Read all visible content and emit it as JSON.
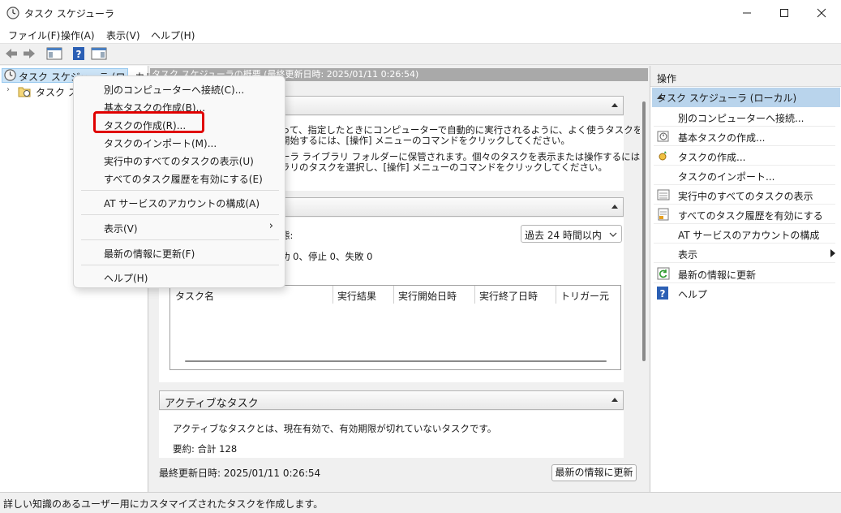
{
  "window": {
    "title": "タスク スケジューラ",
    "menu": [
      "ファイル(F)",
      "操作(A)",
      "表示(V)",
      "ヘルプ(H)"
    ]
  },
  "tree": {
    "root": "タスク スケジューラ (ローカル)",
    "child": "タスク スケジューラ ライブラリ"
  },
  "summary": {
    "header": "タスク スケジューラの概要 (最終更新日時: 2025/01/11 0:26:54)",
    "overview_text1": "って、指定したときにコンピューターで自動的に実行されるように、よく使うタスクを作成し",
    "overview_text2": "開始するには、[操作] メニューのコマンドをクリックしてください。",
    "overview_text3": "ーラ ライブラリ フォルダーに保管されます。個々のタスクを表示または操作するには、タ",
    "overview_text4": "ラリのタスクを選択し、[操作] メニューのコマンドをクリックしてください。",
    "status_label": "態:",
    "status_counts": "功 0、停止 0、失敗 0",
    "period": "過去 24 時間以内",
    "table_headers": [
      "タスク名",
      "実行結果",
      "実行開始日時",
      "実行終了日時",
      "トリガー元"
    ],
    "active_header": "アクティブなタスク",
    "active_desc": "アクティブなタスクとは、現在有効で、有効期限が切れていないタスクです。",
    "active_summary": "要約: 合計 128",
    "last_updated": "最終更新日時: 2025/01/11 0:26:54",
    "refresh_button": "最新の情報に更新"
  },
  "actions": {
    "header": "操作",
    "section": "タスク スケジューラ (ローカル)",
    "items": [
      {
        "label": "別のコンピューターへ接続...",
        "icon": "none"
      },
      {
        "label": "基本タスクの作成...",
        "icon": "basic-task-icon"
      },
      {
        "label": "タスクの作成...",
        "icon": "create-task-icon"
      },
      {
        "label": "タスクのインポート...",
        "icon": "none"
      },
      {
        "label": "実行中のすべてのタスクの表示",
        "icon": "running-tasks-icon"
      },
      {
        "label": "すべてのタスク履歴を有効にする",
        "icon": "history-icon"
      },
      {
        "label": "AT サービスのアカウントの構成",
        "icon": "none"
      },
      {
        "label": "表示",
        "icon": "none"
      },
      {
        "label": "最新の情報に更新",
        "icon": "refresh-icon"
      },
      {
        "label": "ヘルプ",
        "icon": "help-icon"
      }
    ]
  },
  "context_menu": {
    "items": [
      "別のコンピューターへ接続(C)...",
      "基本タスクの作成(B)...",
      "タスクの作成(R)...",
      "タスクのインポート(M)...",
      "実行中のすべてのタスクの表示(U)",
      "すべてのタスク履歴を有効にする(E)",
      "AT サービスのアカウントの構成(A)",
      "表示(V)",
      "最新の情報に更新(F)",
      "ヘルプ(H)"
    ],
    "highlighted": "タスクの作成(R)..."
  },
  "status_bar": "詳しい知識のあるユーザー用にカスタマイズされたタスクを作成します。",
  "colors": {
    "highlight_border": "#e00000",
    "selected_section": "#b9d4ec"
  }
}
